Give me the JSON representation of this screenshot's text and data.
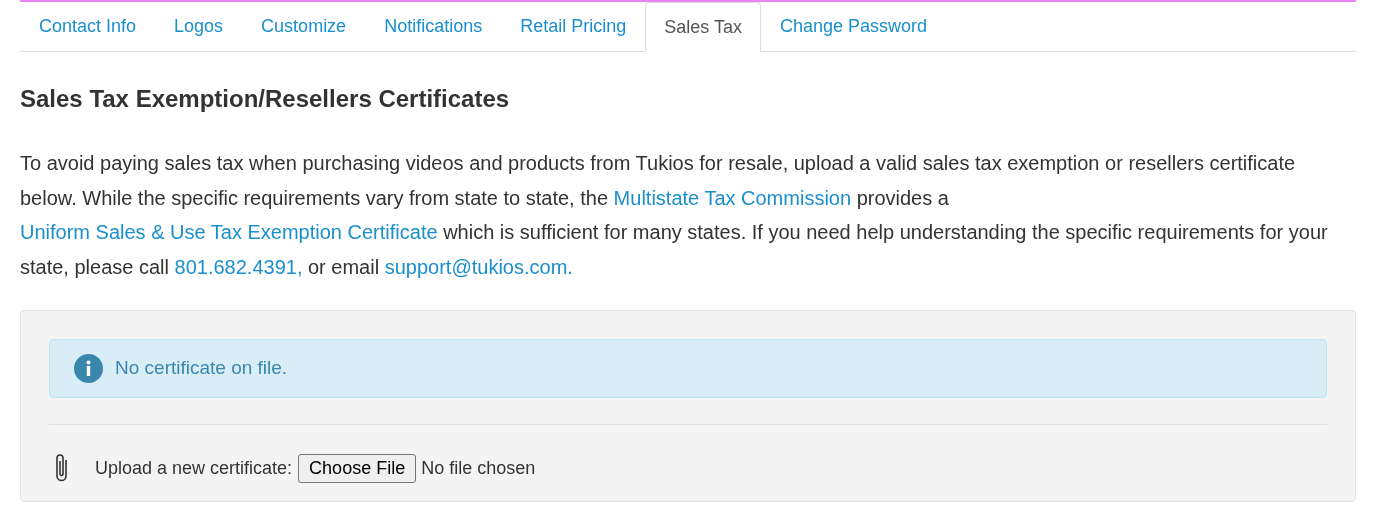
{
  "tabs": [
    {
      "label": "Contact Info",
      "selected": false
    },
    {
      "label": "Logos",
      "selected": false
    },
    {
      "label": "Customize",
      "selected": false
    },
    {
      "label": "Notifications",
      "selected": false
    },
    {
      "label": "Retail Pricing",
      "selected": false
    },
    {
      "label": "Sales Tax",
      "selected": true
    },
    {
      "label": "Change Password",
      "selected": false
    }
  ],
  "heading": "Sales Tax Exemption/Resellers Certificates",
  "intro": [
    {
      "kind": "text",
      "text": "To avoid paying sales tax when purchasing videos and products from Tukios for resale, upload a valid sales tax exemption or resellers certificate below. While the specific requirements vary from state to state, the "
    },
    {
      "kind": "link",
      "text": "Multistate Tax Commission"
    },
    {
      "kind": "text",
      "text": " provides a "
    },
    {
      "kind": "link",
      "text": "Uniform Sales & Use Tax Exemption Certificate"
    },
    {
      "kind": "text",
      "text": " which is sufficient for many states. If you need help understanding the specific requirements for your state, please call "
    },
    {
      "kind": "link",
      "text": "801.682.4391,"
    },
    {
      "kind": "text",
      "text": " or email "
    },
    {
      "kind": "link",
      "text": "support@tukios.com."
    }
  ],
  "alert": {
    "message": "No certificate on file."
  },
  "upload": {
    "label": "Upload a new certificate:",
    "button": "Choose File",
    "status": "No file chosen"
  }
}
